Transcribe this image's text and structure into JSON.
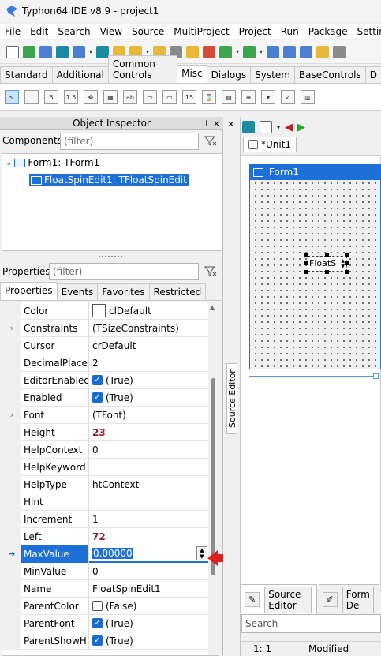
{
  "window": {
    "title": "Typhon64 IDE v8.9 - project1"
  },
  "menu": [
    "File",
    "Edit",
    "Search",
    "View",
    "Source",
    "MultiProject",
    "Project",
    "Run",
    "Package",
    "Settings"
  ],
  "palette_tabs": [
    "Standard",
    "Additional",
    "Common Controls",
    "Misc",
    "Dialogs",
    "System",
    "BaseControls",
    "D"
  ],
  "active_palette_tab": "Misc",
  "object_inspector": {
    "title": "Object Inspector",
    "pin_glyphs": "⊥ ×",
    "components_label": "Components",
    "components_filter_placeholder": "(filter)",
    "tree": [
      {
        "label": "Form1: TForm1"
      },
      {
        "label": "FloatSpinEdit1: TFloatSpinEdit"
      }
    ],
    "properties_label": "Properties",
    "properties_filter_placeholder": "(filter)",
    "tabs": [
      "Properties",
      "Events",
      "Favorites",
      "Restricted"
    ],
    "rows": [
      {
        "name": "Color",
        "value": "clDefault"
      },
      {
        "name": "Constraints",
        "value": "(TSizeConstraints)"
      },
      {
        "name": "Cursor",
        "value": "crDefault"
      },
      {
        "name": "DecimalPlaces",
        "value": "2"
      },
      {
        "name": "EditorEnabled",
        "value": "(True)"
      },
      {
        "name": "Enabled",
        "value": "(True)"
      },
      {
        "name": "Font",
        "value": "(TFont)"
      },
      {
        "name": "Height",
        "value": "23"
      },
      {
        "name": "HelpContext",
        "value": "0"
      },
      {
        "name": "HelpKeyword",
        "value": ""
      },
      {
        "name": "HelpType",
        "value": "htContext"
      },
      {
        "name": "Hint",
        "value": ""
      },
      {
        "name": "Increment",
        "value": "1"
      },
      {
        "name": "Left",
        "value": "72"
      },
      {
        "name": "MaxValue",
        "value": "0.00000"
      },
      {
        "name": "MinValue",
        "value": "0"
      },
      {
        "name": "Name",
        "value": "FloatSpinEdit1"
      },
      {
        "name": "ParentColor",
        "value": "(False)"
      },
      {
        "name": "ParentFont",
        "value": "(True)"
      },
      {
        "name": "ParentShowHint",
        "value": "(True)"
      }
    ]
  },
  "editor": {
    "vertical_tab": "Source Editor",
    "unit_tab": "*Unit1",
    "form_caption": "Form1",
    "spin_text": "FloatS",
    "bottom_tabs": [
      "Source Editor",
      "Form De"
    ],
    "search_placeholder": "Search",
    "status_pos": "1:  1",
    "status_state": "Modified"
  },
  "colors": {
    "accent": "#1e6fd6",
    "arrow": "#e02020",
    "modified_value": "#9a1f1f"
  }
}
